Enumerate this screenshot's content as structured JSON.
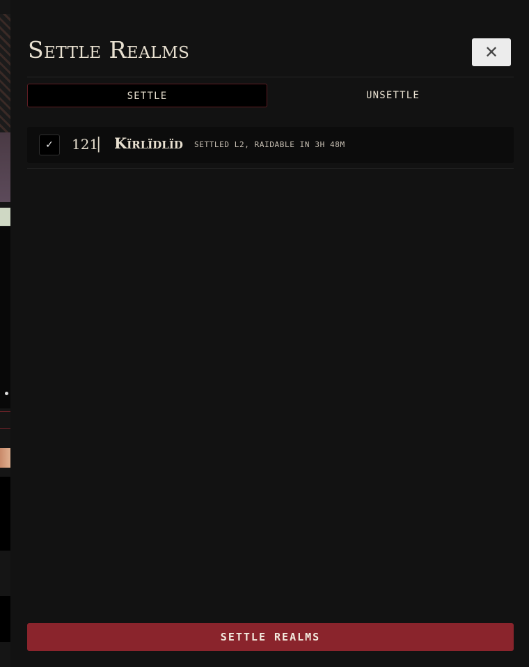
{
  "drawer": {
    "title": "Settle Realms",
    "close_icon": "close-icon",
    "close_glyph": "✕"
  },
  "tabs": [
    {
      "label": "SETTLE",
      "active": true
    },
    {
      "label": "UNSETTLE",
      "active": false
    }
  ],
  "realms": [
    {
      "selected": true,
      "check_glyph": "✓",
      "id": "121",
      "separator": "|",
      "name": "Kïrlïdlïd",
      "status": "SETTLED L2, RAIDABLE IN 3H 48M"
    }
  ],
  "footer": {
    "settle_button_label": "SETTLE REALMS"
  },
  "colors": {
    "accent": "#8a242c",
    "tab_border": "#5e1c22",
    "background": "#121212",
    "text": "#e8e0d0"
  }
}
